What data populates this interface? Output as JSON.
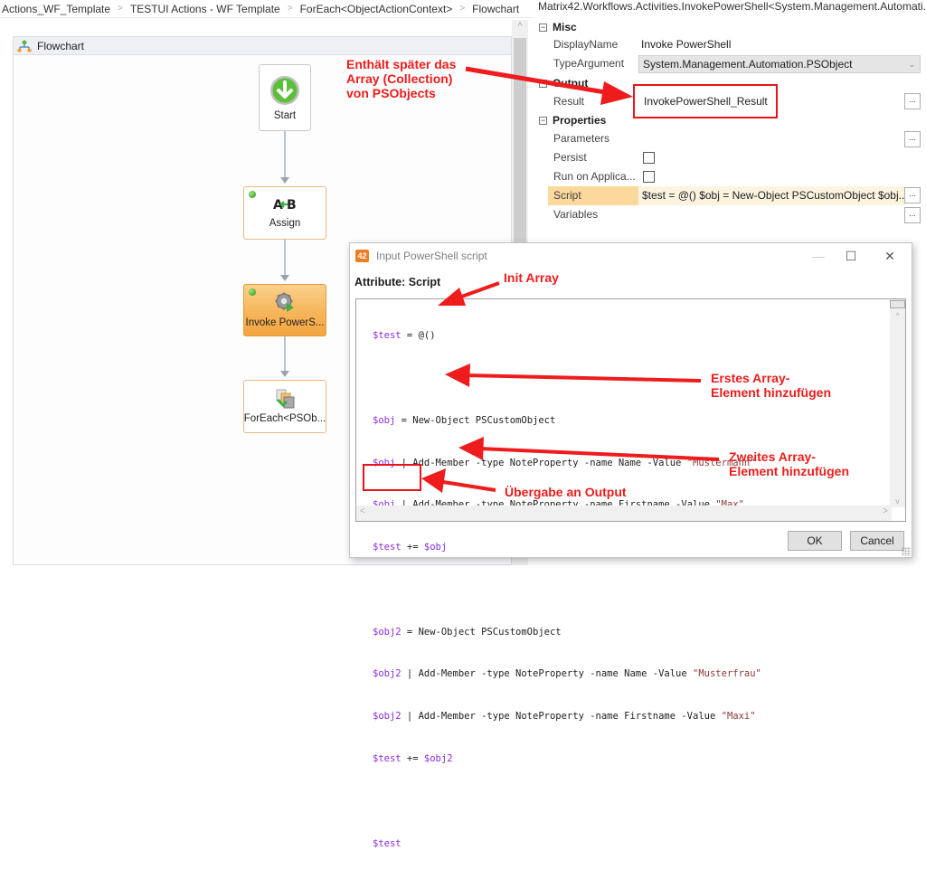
{
  "breadcrumb": [
    "Actions_WF_Template",
    "TESTUI Actions -  WF Template",
    "ForEach<ObjectActionContext>",
    "Flowchart"
  ],
  "designer": {
    "panel_title": "Flowchart",
    "nodes": [
      {
        "label": "Start",
        "icon": "start-arrow-icon"
      },
      {
        "label": "Assign",
        "icon": "assign-icon"
      },
      {
        "label": "Invoke PowerS...",
        "icon": "gear-play-icon"
      },
      {
        "label": "ForEach<PSOb...",
        "icon": "foreach-icon"
      }
    ]
  },
  "properties": {
    "title": "Matrix42.Workflows.Activities.InvokePowerShell<System.Management.Automati...",
    "categories": {
      "misc": "Misc",
      "output": "Output",
      "properties": "Properties"
    },
    "display_name_label": "DisplayName",
    "display_name_value": "Invoke PowerShell",
    "type_argument_label": "TypeArgument",
    "type_argument_value": "System.Management.Automation.PSObject",
    "result_label": "Result",
    "result_value": "InvokePowerShell_Result",
    "parameters_label": "Parameters",
    "persist_label": "Persist",
    "persist_checked": false,
    "run_on_app_label": "Run on Applica...",
    "run_on_app_checked": false,
    "script_label": "Script",
    "script_value": "$test = @()  $obj = New-Object PSCustomObject $obj...",
    "variables_label": "Variables",
    "ellipsis": "..."
  },
  "dialog": {
    "icon_text": "42",
    "title": "Input PowerShell script",
    "attribute_label": "Attribute: Script",
    "script_lines": [
      "$test = @()",
      "",
      "$obj = New-Object PSCustomObject",
      "$obj | Add-Member -type NoteProperty -name Name -Value \"Mustermann\"",
      "$obj | Add-Member -type NoteProperty -name Firstname -Value \"Max\"",
      "$test += $obj",
      "",
      "$obj2 = New-Object PSCustomObject",
      "$obj2 | Add-Member -type NoteProperty -name Name -Value \"Musterfrau\"",
      "$obj2 | Add-Member -type NoteProperty -name Firstname -Value \"Maxi\"",
      "$test += $obj2",
      "",
      "$test"
    ],
    "ok_label": "OK",
    "cancel_label": "Cancel",
    "minimize": "—",
    "maximize": "☐",
    "close": "✕"
  },
  "annotations": {
    "result_note": [
      "Enthält später das",
      "Array (Collection)",
      "von PSObjects"
    ],
    "init_array": "Init Array",
    "first_element": [
      "Erstes Array-",
      "Element hinzufügen"
    ],
    "second_element": [
      "Zweites Array-",
      "Element hinzufügen"
    ],
    "output": "Übergabe an Output",
    "color": "#EE1C1C"
  }
}
